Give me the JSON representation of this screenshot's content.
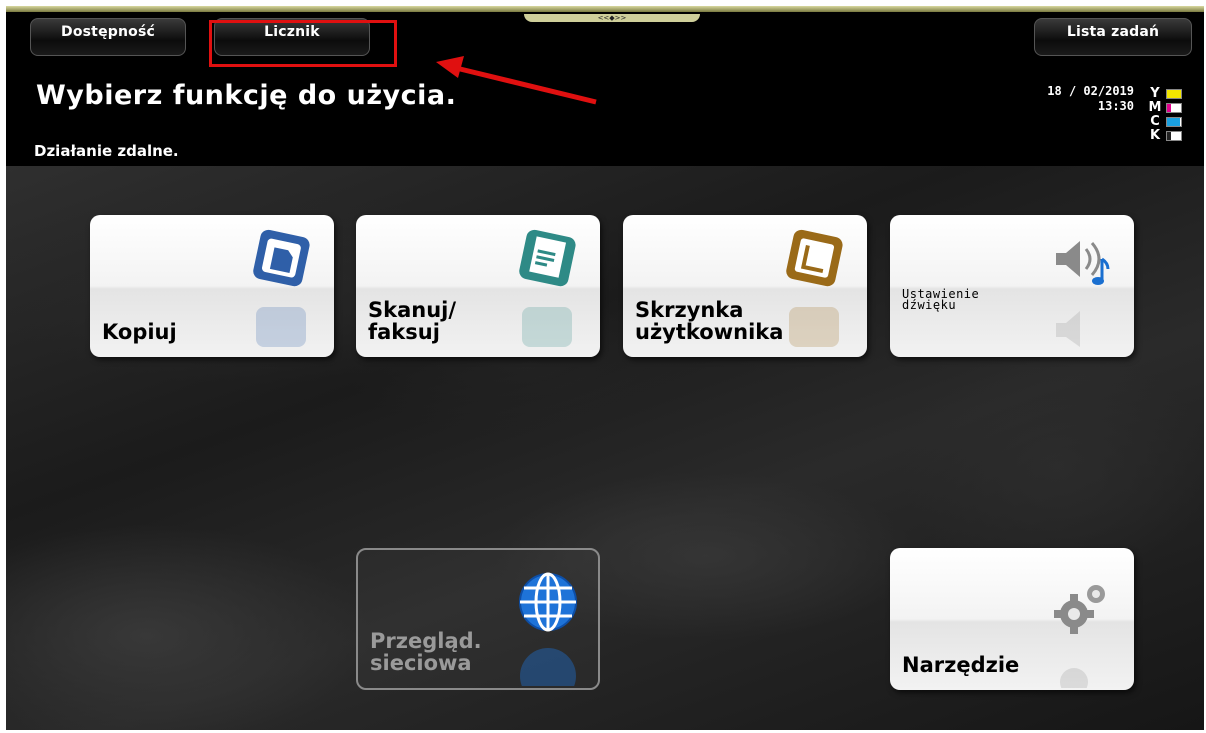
{
  "header": {
    "accessibility_label": "Dostępność",
    "counter_label": "Licznik",
    "job_list_label": "Lista zadań",
    "handle_symbol": "<<◆>>",
    "title": "Wybierz funkcję do użycia.",
    "subtitle": "Działanie zdalne.",
    "date": "18 / 02/2019",
    "time": "13:30"
  },
  "toner": [
    {
      "letter": "Y",
      "color": "#f2e600",
      "level": 1.0
    },
    {
      "letter": "M",
      "color": "#e0008c",
      "level": 0.3
    },
    {
      "letter": "C",
      "color": "#1aa0e0",
      "level": 0.9
    },
    {
      "letter": "K",
      "color": "#222222",
      "level": 0.3
    }
  ],
  "tiles": {
    "copy": {
      "label": "Kopiuj",
      "icon": "copy-icon",
      "color": "#2f5fa8"
    },
    "scan": {
      "label": "Skanuj/\nfaksuj",
      "icon": "scan-fax-icon",
      "color": "#2e8a86"
    },
    "box": {
      "label": "Skrzynka\nużytkownika",
      "icon": "user-box-icon",
      "color": "#9a6a18"
    },
    "sound": {
      "label": "Ustawienie\ndźwięku",
      "icon": "speaker-icon"
    },
    "web": {
      "label": "Przegląd.\nsieciowa",
      "icon": "globe-icon"
    },
    "tools": {
      "label": "Narzędzie",
      "icon": "gear-icon"
    }
  },
  "annotation": {
    "highlight_color": "#e01010"
  }
}
